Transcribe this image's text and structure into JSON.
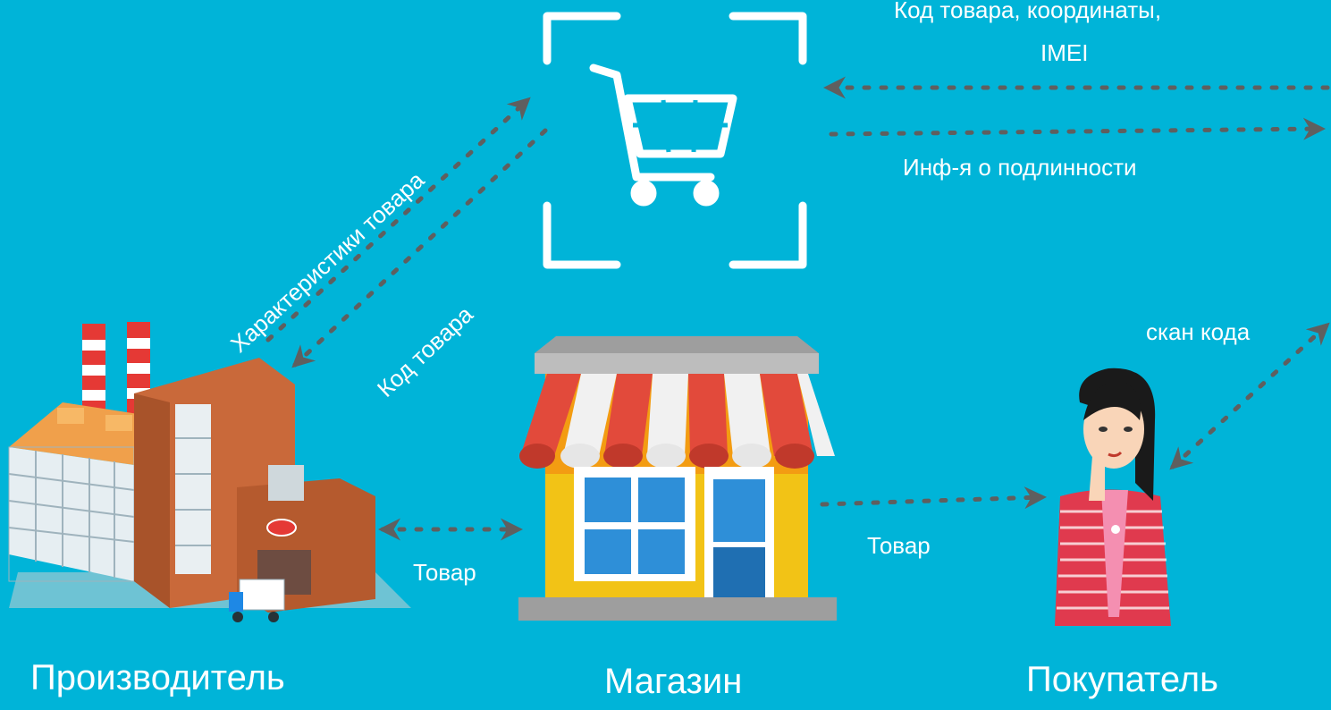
{
  "colors": {
    "background": "#00b4d8",
    "foreground": "#ffffff",
    "arrow": "#5f5f5f",
    "awning_red": "#e24a3b",
    "shop_yellow": "#f2c316",
    "window_blue": "#2e8fd8",
    "brick": "#c9693a",
    "shirt_red": "#e03a4e"
  },
  "nodes": {
    "manufacturer": {
      "label": "Производитель",
      "icon": "factory-icon"
    },
    "shop": {
      "label": "Магазин",
      "icon": "storefront-icon"
    },
    "buyer": {
      "label": "Покупатель",
      "icon": "thinking-woman-icon"
    },
    "scanner": {
      "icon": "shopping-cart-scan-icon"
    }
  },
  "edges": {
    "top_incoming_line1": "Код товара, координаты,",
    "top_incoming_line2": "IMEI",
    "top_outgoing": "Инф-я о подлинности",
    "characteristics": "Характеристики товара",
    "product_code": "Код товара",
    "scan_code": "скан кода",
    "goods_factory_shop": "Товар",
    "goods_shop_buyer": "Товар"
  }
}
